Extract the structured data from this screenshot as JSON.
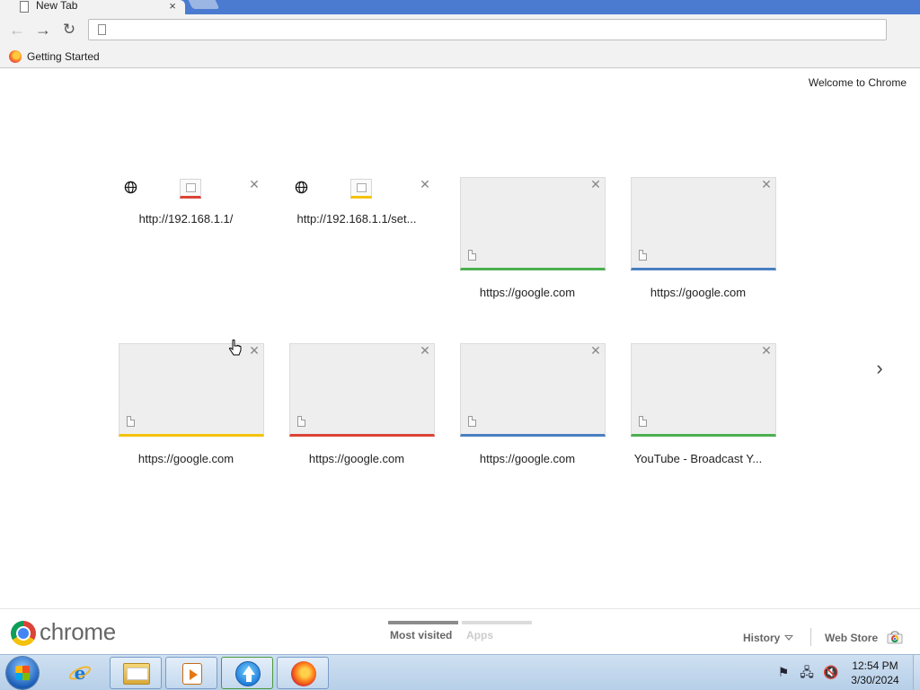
{
  "tab": {
    "title": "New Tab",
    "close": "×"
  },
  "toolbar": {
    "back": "←",
    "forward": "→",
    "reload": "↻",
    "omnibox_value": "",
    "omnibox_placeholder": ""
  },
  "bookmarks": [
    {
      "label": "Getting Started",
      "icon": "firefox-icon"
    }
  ],
  "page": {
    "welcome": "Welcome to Chrome",
    "tiles_row1": [
      {
        "title": "http://192.168.1.1/",
        "type": "plain",
        "accent": "#db4437"
      },
      {
        "title": "http://192.168.1.1/set...",
        "type": "plain",
        "accent": "#f4c20d"
      },
      {
        "title": "https://google.com",
        "type": "thumb",
        "accent": "#4caf50"
      },
      {
        "title": "https://google.com",
        "type": "thumb",
        "accent": "#4a7fc1"
      }
    ],
    "tiles_row2": [
      {
        "title": "https://google.com",
        "type": "thumb",
        "accent": "#f4c20d"
      },
      {
        "title": "https://google.com",
        "type": "thumb",
        "accent": "#db4437"
      },
      {
        "title": "https://google.com",
        "type": "thumb",
        "accent": "#4a7fc1"
      },
      {
        "title": "YouTube - Broadcast Y...",
        "type": "thumb",
        "accent": "#4caf50"
      }
    ],
    "tile_close": "✕",
    "next_arrow": "›"
  },
  "footer": {
    "brand": "chrome",
    "sections": [
      {
        "label": "Most visited",
        "active": true
      },
      {
        "label": "Apps",
        "active": false
      }
    ],
    "history": "History",
    "webstore": "Web Store"
  },
  "taskbar": {
    "apps": [
      "internet-explorer",
      "windows-explorer",
      "media-player",
      "upload-app",
      "firefox"
    ],
    "tray": {
      "flag": "⚑",
      "network": "🖧",
      "volume": "🔇"
    },
    "time": "12:54 PM",
    "date": "3/30/2024"
  }
}
